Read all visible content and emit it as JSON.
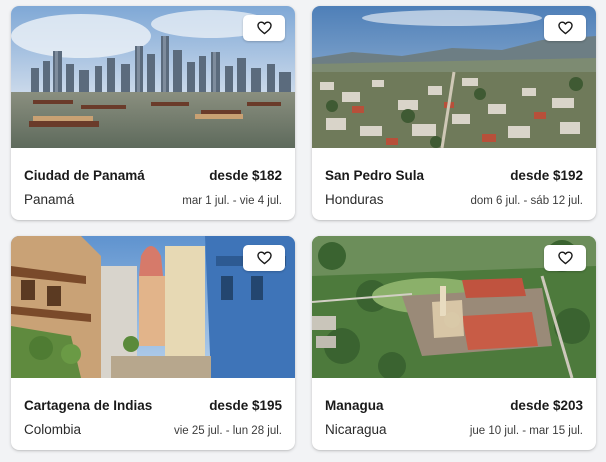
{
  "cards": [
    {
      "city": "Ciudad de Panamá",
      "price": "desde $182",
      "country": "Panamá",
      "dates": "mar 1 jul. - vie 4 jul.",
      "photo_icon": "panama-city-skyline-photo"
    },
    {
      "city": "San Pedro Sula",
      "price": "desde $192",
      "country": "Honduras",
      "dates": "dom 6 jul. - sáb 12 jul.",
      "photo_icon": "san-pedro-sula-aerial-photo"
    },
    {
      "city": "Cartagena de Indias",
      "price": "desde $195",
      "country": "Colombia",
      "dates": "vie 25 jul. - lun 28 jul.",
      "photo_icon": "cartagena-street-photo"
    },
    {
      "city": "Managua",
      "price": "desde $203",
      "country": "Nicaragua",
      "dates": "jue 10 jul. - mar 15 jul.",
      "photo_icon": "managua-cathedral-aerial-photo"
    }
  ],
  "favorite_icon": "heart-icon",
  "colors": {
    "card_bg": "#ffffff",
    "page_bg": "#f2f3f5",
    "text": "#1a1a1a"
  }
}
